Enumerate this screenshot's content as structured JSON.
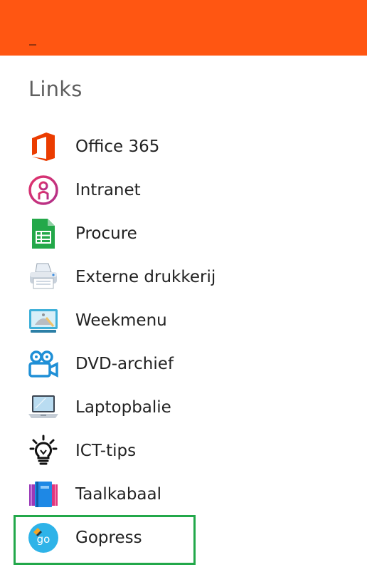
{
  "colors": {
    "header": "#ff5612",
    "selection": "#22a84a"
  },
  "header": {
    "minimize_symbol": "_"
  },
  "section": {
    "title": "Links"
  },
  "links": [
    {
      "label": "Office 365",
      "icon": "office-365-icon"
    },
    {
      "label": "Intranet",
      "icon": "intranet-icon"
    },
    {
      "label": "Procure",
      "icon": "spreadsheet-icon"
    },
    {
      "label": "Externe drukkerij",
      "icon": "printer-icon"
    },
    {
      "label": "Weekmenu",
      "icon": "food-menu-icon"
    },
    {
      "label": "DVD-archief",
      "icon": "video-camera-icon"
    },
    {
      "label": "Laptopbalie",
      "icon": "laptop-icon"
    },
    {
      "label": "ICT-tips",
      "icon": "lightbulb-icon"
    },
    {
      "label": "Taalkabaal",
      "icon": "books-icon"
    },
    {
      "label": "Gopress",
      "icon": "gopress-icon",
      "selected": true
    }
  ]
}
